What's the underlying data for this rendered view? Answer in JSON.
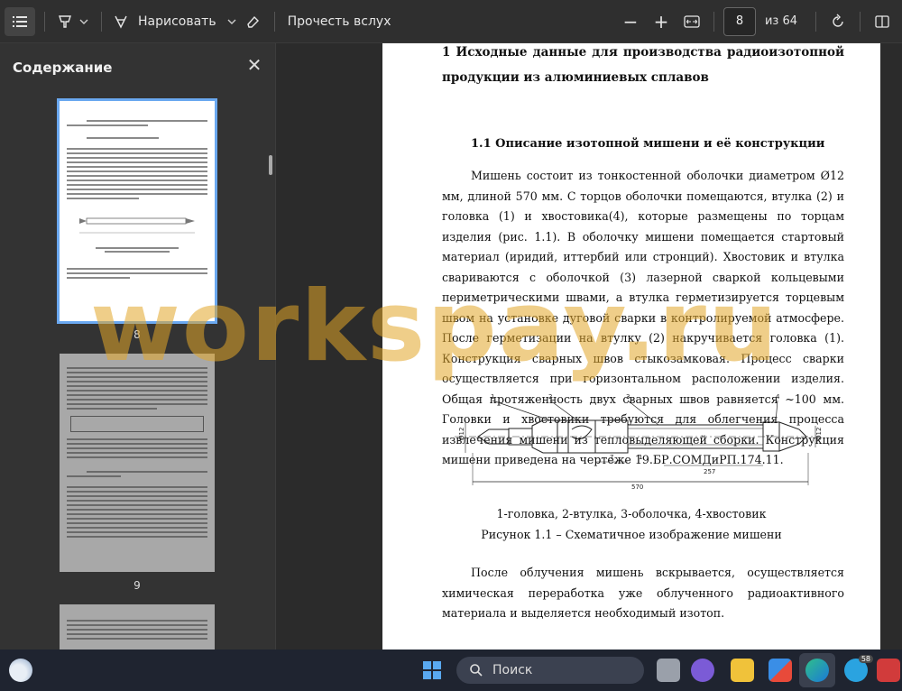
{
  "toolbar": {
    "draw_label": "Нарисовать",
    "read_aloud_label": "Прочесть вслух",
    "page_current": "8",
    "page_total": "из 64",
    "minus": "−",
    "plus": "+"
  },
  "sidebar": {
    "title": "Содержание",
    "thumbnails": [
      {
        "page": "8"
      },
      {
        "page": "9"
      }
    ]
  },
  "document": {
    "heading1": "1      Исходные данные для производства радиоизотопной продукции из алюминиевых сплавов",
    "heading2": "1.1      Описание изотопной мишени и её конструкции",
    "paragraph1": "Мишень состоит из тонкостенной оболочки диаметром Ø12 мм, длиной 570 мм. С торцов оболочки помещаются, втулка (2) и головка (1) и хвостовика(4), которые размещены по торцам изделия (рис. 1.1). В оболочку мишени помещается стартовый материал (иридий, иттербий или стронций). Хвостовик и втулка свариваются с оболочкой (3) лазерной сваркой кольцевыми периметрическими швами, а втулка герметизируется торцевым швом на установке дуговой сварки в контролируемой атмосфере. После герметизации на втулку (2) накручивается головка (1). Конструкция сварных швов стыкозамковая. Процесс сварки осуществляется при горизонтальном расположении изделия. Общая протяженность двух сварных швов равняется ~100 мм. Головки и хвостовики требуются для облегчения процесса извлечения мишени из тепловыделяющей сборки. Конструкция мишени приведена на чертеже 19.БР.СОМДиРП.174.11.",
    "figure_labels": {
      "l1": "1",
      "l2": "2",
      "l3": "3",
      "l4": "4",
      "d_left": "Ø12",
      "d_right": "Ø12",
      "dim_total": "570",
      "dim_257": "257",
      "dim_7": "7",
      "dim_1": "1"
    },
    "figure_legend": "1-головка, 2-втулка, 3-оболочка, 4-хвостовик",
    "figure_caption": "Рисунок 1.1 – Схематичное изображение мишени",
    "paragraph2": "После облучения мишень вскрывается, осуществляется химическая переработка уже облученного радиоактивного материала и выделяется необходимый изотоп."
  },
  "watermark": "workspay.ru",
  "taskbar": {
    "search_label": "Поиск",
    "badge": "58"
  }
}
